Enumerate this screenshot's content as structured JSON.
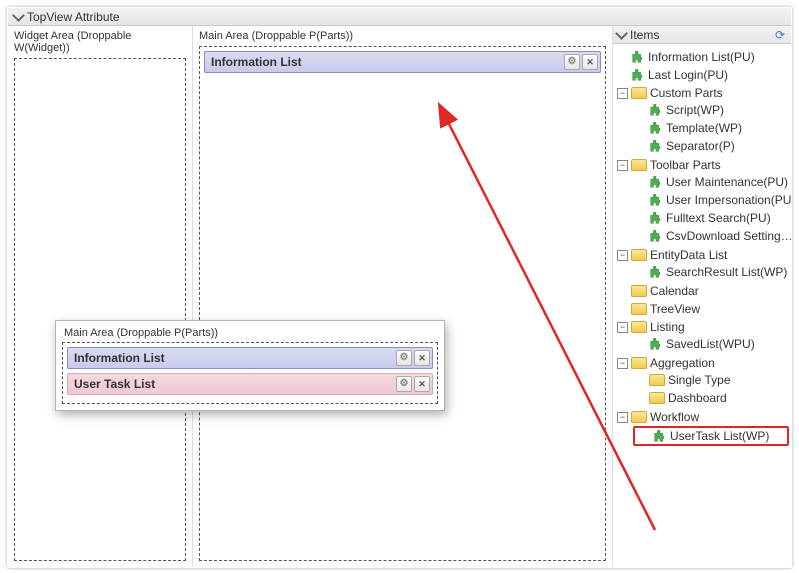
{
  "titlebar": {
    "title": "TopView Attribute"
  },
  "widgetArea": {
    "label": "Widget Area (Droppable W(Widget))"
  },
  "mainArea": {
    "label": "Main Area (Droppable P(Parts))",
    "parts": [
      {
        "title": "Information List"
      }
    ]
  },
  "floatPanel": {
    "label": "Main Area (Droppable P(Parts))",
    "parts": [
      {
        "title": "Information List"
      },
      {
        "title": "User Task List"
      }
    ]
  },
  "itemsPanel": {
    "title": "Items",
    "topParts": [
      "Information List(PU)",
      "Last Login(PU)"
    ],
    "folders": [
      {
        "name": "Custom Parts",
        "expanded": true,
        "children": [
          "Script(WP)",
          "Template(WP)",
          "Separator(P)"
        ]
      },
      {
        "name": "Toolbar Parts",
        "expanded": true,
        "children": [
          "User Maintenance(PU)",
          "User Impersonation(PU)",
          "Fulltext Search(PU)",
          "CsvDownload Setting…"
        ]
      },
      {
        "name": "EntityData List",
        "expanded": true,
        "children": [
          "SearchResult List(WP)"
        ]
      },
      {
        "name": "Calendar",
        "expanded": false,
        "children": []
      },
      {
        "name": "TreeView",
        "expanded": false,
        "children": []
      },
      {
        "name": "Listing",
        "expanded": true,
        "children": [
          "SavedList(WPU)"
        ]
      },
      {
        "name": "Aggregation",
        "expanded": true,
        "children": [
          "Single Type",
          "Dashboard"
        ]
      },
      {
        "name": "Workflow",
        "expanded": true,
        "children": [
          "UserTask List(WP)"
        ],
        "highlight": true
      }
    ]
  }
}
